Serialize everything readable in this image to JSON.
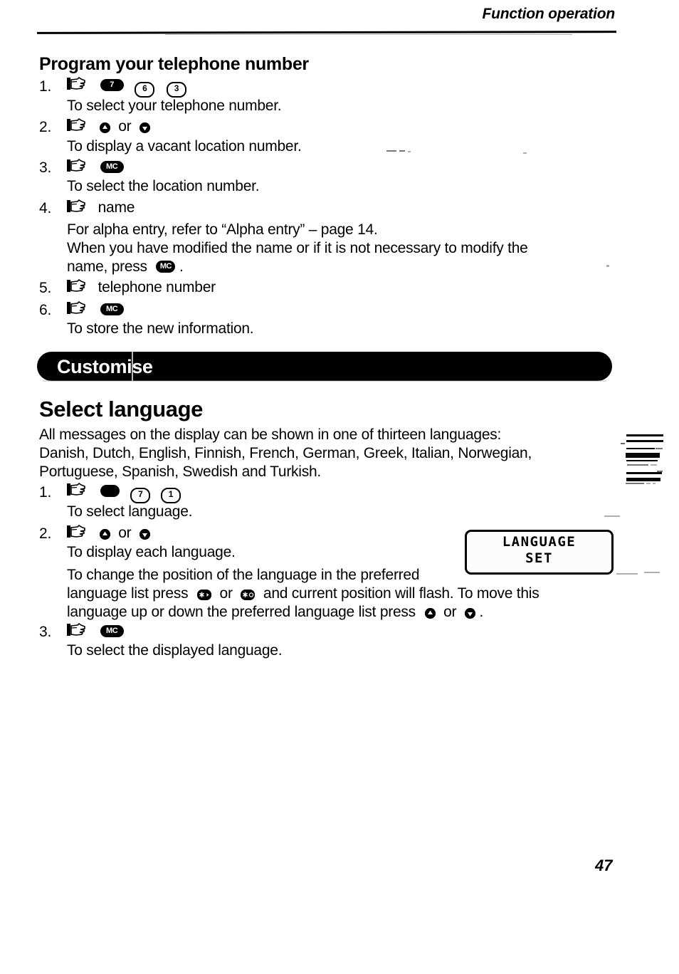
{
  "page": {
    "header_title": "Function operation",
    "folio": "47"
  },
  "section_phone": {
    "heading": "Program your telephone number",
    "steps": [
      {
        "number": "1.",
        "keys": [
          "hand-icon",
          "key-7",
          "key-6",
          "key-3"
        ],
        "key_labels": [
          "7",
          "6",
          "3"
        ],
        "description": "To select your telephone number."
      },
      {
        "number": "2.",
        "key_labels": [],
        "inline_prefix": "",
        "or_text": "or",
        "description": "To display a vacant location number."
      },
      {
        "number": "3.",
        "key_labels": [
          "MC"
        ],
        "description": "To select the location number."
      },
      {
        "number": "4.",
        "label": "name",
        "para_1": "For alpha entry, refer to “Alpha entry” – page 14.",
        "para_2a": "When you have modified the name or if it is not necessary to modify the",
        "para_2b_before": "name, press",
        "para_2b_after": "."
      },
      {
        "number": "5.",
        "label": "telephone number"
      },
      {
        "number": "6.",
        "key_labels": [
          "MC"
        ],
        "description": "To store the new information."
      }
    ]
  },
  "banner": {
    "label": "Customise",
    "color": "#070707",
    "text_color": "#ffffff"
  },
  "section_language": {
    "heading": "Select language",
    "intro_line_1": "All messages on the display can be shown in one of thirteen languages:",
    "intro_line_2": "Danish, Dutch, English, Finnish, French, German, Greek, Italian, Norwegian,",
    "intro_line_3": "Portuguese, Spanish, Swedish and Turkish.",
    "languages": [
      "Danish",
      "Dutch",
      "English",
      "Finnish",
      "French",
      "German",
      "Greek",
      "Italian",
      "Norwegian",
      "Portuguese",
      "Spanish",
      "Swedish",
      "Turkish"
    ],
    "language_count": "thirteen",
    "steps": [
      {
        "number": "1.",
        "key_labels": [
          "7",
          "1"
        ],
        "description": "To select language."
      },
      {
        "number": "2.",
        "or_text": "or",
        "description": "To display each language.",
        "para_line_1": "To change the position of the language in the preferred",
        "para_line_2a": "language list press",
        "para_line_2b": "or",
        "para_line_2c": "and current position will flash. To move this",
        "para_line_3a": "language up or down the preferred language list press",
        "para_line_3b": "or",
        "para_line_3c": "."
      },
      {
        "number": "3.",
        "key_labels": [
          "MC"
        ],
        "description": "To select the displayed language."
      }
    ]
  },
  "lcd_display": {
    "line_1": "LANGUAGE",
    "line_2": "SET"
  }
}
